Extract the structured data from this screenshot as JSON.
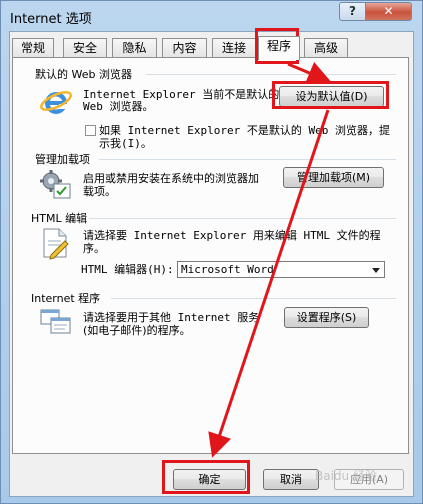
{
  "window": {
    "title": "Internet 选项",
    "help_label": "?",
    "close_label": "✕"
  },
  "tabs": [
    {
      "label": "常规"
    },
    {
      "label": "安全"
    },
    {
      "label": "隐私"
    },
    {
      "label": "内容"
    },
    {
      "label": "连接"
    },
    {
      "label": "程序",
      "active": true
    },
    {
      "label": "高级"
    }
  ],
  "default_browser": {
    "title": "默认的 Web 浏览器",
    "icon": "ie-logo-icon",
    "line1": "Internet Explorer 当前不是默认的",
    "line2": "Web 浏览器。",
    "button": "设为默认值(D)",
    "checkbox_checked": false,
    "checkbox_line1": "如果 Internet Explorer 不是默认的 Web 浏览器，提",
    "checkbox_line2": "示我(I)。"
  },
  "addons": {
    "title": "管理加载项",
    "icon": "gear-addons-icon",
    "line1": "启用或禁用安装在系统中的浏览器加",
    "line2": "载项。",
    "button": "管理加载项(M)"
  },
  "html_editing": {
    "title": "HTML 编辑",
    "icon": "html-editor-icon",
    "line1": "请选择要 Internet Explorer 用来编辑 HTML 文件的程",
    "line2": "序。",
    "editor_label": "HTML 编辑器(H):",
    "editor_value": "Microsoft Word"
  },
  "internet_programs": {
    "title": "Internet 程序",
    "icon": "programs-icon",
    "line1": "请选择要用于其他 Internet 服务",
    "line2": "(如电子邮件)的程序。",
    "button": "设置程序(S)"
  },
  "footer": {
    "ok": "确定",
    "cancel": "取消",
    "apply": "应用(A)"
  },
  "annotation_color": "#e0161b",
  "watermark": "Baidu 经验"
}
